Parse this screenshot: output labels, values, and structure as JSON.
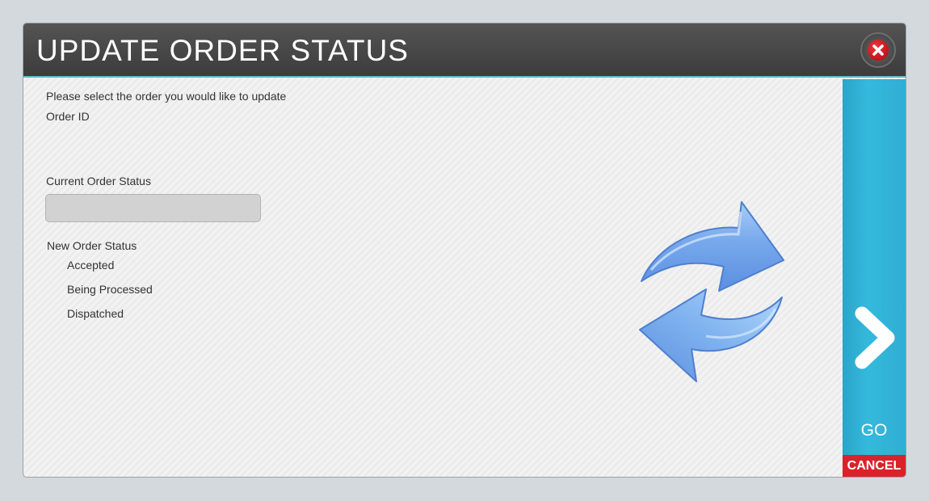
{
  "dialog": {
    "title": "UPDATE ORDER STATUS"
  },
  "form": {
    "instruction": "Please select the order you would like to update",
    "order_id_label": "Order ID",
    "current_status_label": "Current Order Status",
    "current_status_value": "",
    "new_status_label": "New Order Status",
    "new_status_options": [
      "Accepted",
      "Being Processed",
      "Dispatched"
    ]
  },
  "actions": {
    "go_label": "GO",
    "cancel_label": "CANCEL"
  },
  "icons": {
    "close": "close-icon",
    "refresh": "refresh-arrows-icon",
    "go": "chevron-right-icon"
  },
  "colors": {
    "titlebar": "#474747",
    "go_panel": "#31b3d8",
    "cancel": "#d8232a",
    "close": "#c8101a",
    "arrows": "#6fa2ea"
  }
}
